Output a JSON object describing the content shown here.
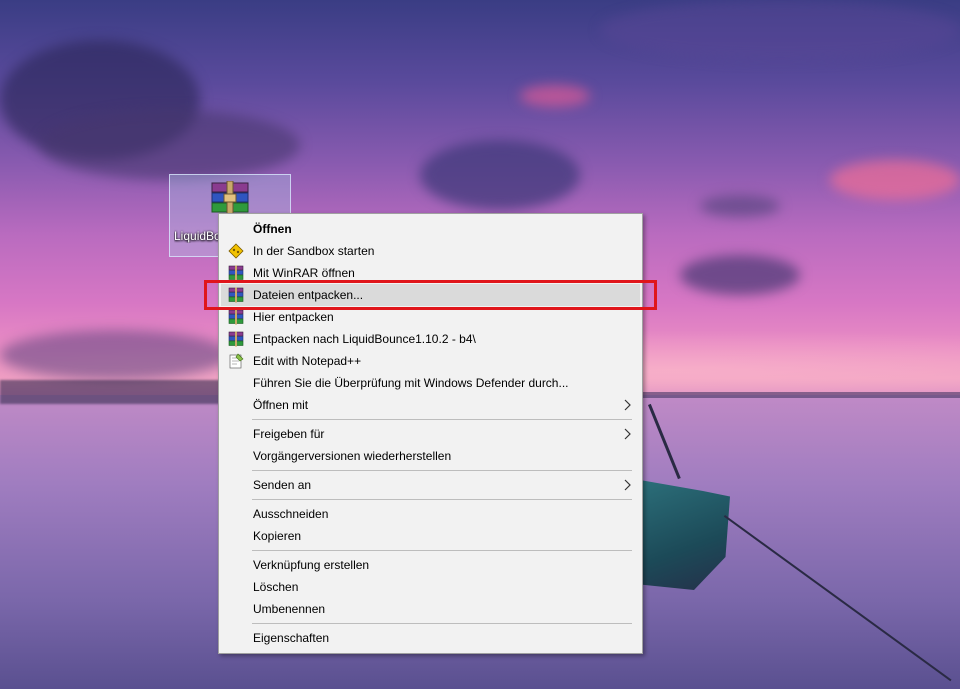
{
  "desktop": {
    "icon": {
      "label": "LiquidBounce1.10.2 - b4",
      "icon": "winrar-archive-icon"
    }
  },
  "context_menu": {
    "groups": [
      {
        "items": [
          {
            "label": "Öffnen",
            "icon": "",
            "bold": true,
            "submenu": false
          },
          {
            "label": "In der Sandbox starten",
            "icon": "sandbox-icon",
            "bold": false,
            "submenu": false
          },
          {
            "label": "Mit WinRAR öffnen",
            "icon": "winrar-icon",
            "bold": false,
            "submenu": false
          },
          {
            "label": "Dateien entpacken...",
            "icon": "winrar-icon",
            "bold": false,
            "submenu": false,
            "highlighted": true
          },
          {
            "label": "Hier entpacken",
            "icon": "winrar-icon",
            "bold": false,
            "submenu": false
          },
          {
            "label": "Entpacken nach LiquidBounce1.10.2 - b4\\",
            "icon": "winrar-icon",
            "bold": false,
            "submenu": false
          },
          {
            "label": "Edit with Notepad++",
            "icon": "notepad-plus-plus-icon",
            "bold": false,
            "submenu": false
          },
          {
            "label": "Führen Sie die Überprüfung mit Windows Defender durch...",
            "icon": "",
            "bold": false,
            "submenu": false
          },
          {
            "label": "Öffnen mit",
            "icon": "",
            "bold": false,
            "submenu": true
          }
        ]
      },
      {
        "items": [
          {
            "label": "Freigeben für",
            "icon": "",
            "bold": false,
            "submenu": true
          },
          {
            "label": "Vorgängerversionen wiederherstellen",
            "icon": "",
            "bold": false,
            "submenu": false
          }
        ]
      },
      {
        "items": [
          {
            "label": "Senden an",
            "icon": "",
            "bold": false,
            "submenu": true
          }
        ]
      },
      {
        "items": [
          {
            "label": "Ausschneiden",
            "icon": "",
            "bold": false,
            "submenu": false
          },
          {
            "label": "Kopieren",
            "icon": "",
            "bold": false,
            "submenu": false
          }
        ]
      },
      {
        "items": [
          {
            "label": "Verknüpfung erstellen",
            "icon": "",
            "bold": false,
            "submenu": false
          },
          {
            "label": "Löschen",
            "icon": "",
            "bold": false,
            "submenu": false
          },
          {
            "label": "Umbenennen",
            "icon": "",
            "bold": false,
            "submenu": false
          }
        ]
      },
      {
        "items": [
          {
            "label": "Eigenschaften",
            "icon": "",
            "bold": false,
            "submenu": false
          }
        ]
      }
    ]
  },
  "colors": {
    "highlight_box": "#e0151b",
    "menu_background": "#f2f2f2",
    "menu_hover": "#dadada"
  }
}
